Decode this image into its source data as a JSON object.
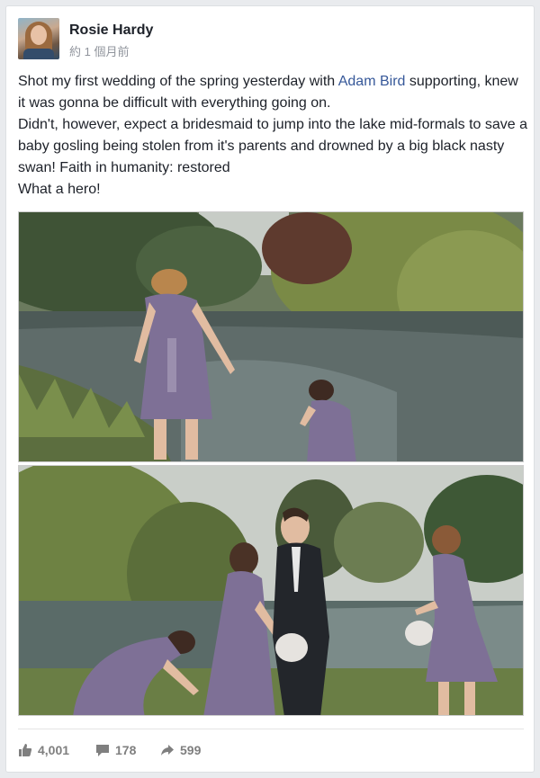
{
  "post": {
    "author": "Rosie Hardy",
    "timestamp": "約 1 個月前",
    "text_before_link": "Shot my first wedding of the spring yesterday with ",
    "link_text": "Adam Bird",
    "text_after_link": " supporting, knew it was gonna be difficult with everything going on.",
    "line2": "Didn't, however, expect a bridesmaid to jump into the lake mid-formals to save a baby gosling being stolen from it's parents and drowned by a big black nasty swan! Faith in humanity: restored",
    "line3": "What a hero!"
  },
  "stats": {
    "likes": "4,001",
    "comments": "178",
    "shares": "599"
  },
  "icons": {
    "like": "thumbs-up-icon",
    "comment": "speech-bubble-icon",
    "share": "share-arrow-icon"
  },
  "colors": {
    "link": "#365899",
    "dress": "#7e7096",
    "stat": "#7f7f7f"
  }
}
